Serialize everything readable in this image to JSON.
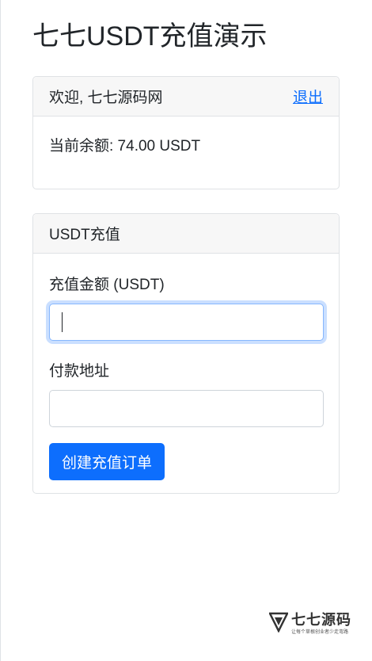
{
  "page": {
    "title": "七七USDT充值演示"
  },
  "account_card": {
    "welcome": "欢迎, 七七源码网",
    "logout_label": "退出",
    "balance_text": "当前余额: 74.00 USDT"
  },
  "recharge_card": {
    "header": "USDT充值",
    "amount_label": "充值金额 (USDT)",
    "amount_value": "",
    "address_label": "付款地址",
    "address_value": "",
    "submit_label": "创建充值订单"
  },
  "watermark": {
    "name": "七七源码",
    "slogan": "让每个草根创业者少走弯路"
  },
  "colors": {
    "primary": "#0d6efd",
    "header_bg": "#f7f7f7",
    "border": "#dfe2e5",
    "focus_ring": "#86b7fe"
  }
}
